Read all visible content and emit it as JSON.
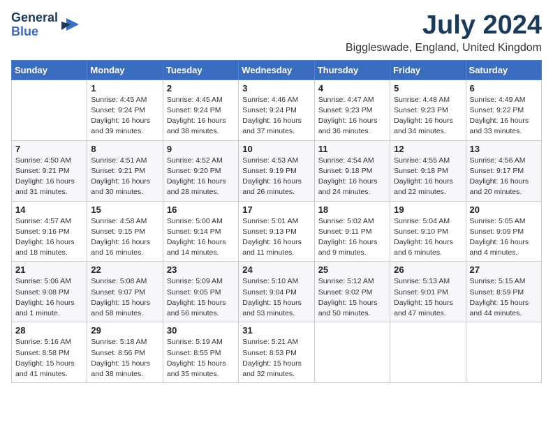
{
  "header": {
    "logo_line1": "General",
    "logo_line2": "Blue",
    "month_year": "July 2024",
    "location": "Biggleswade, England, United Kingdom"
  },
  "weekdays": [
    "Sunday",
    "Monday",
    "Tuesday",
    "Wednesday",
    "Thursday",
    "Friday",
    "Saturday"
  ],
  "weeks": [
    [
      {
        "day": "",
        "info": ""
      },
      {
        "day": "1",
        "info": "Sunrise: 4:45 AM\nSunset: 9:24 PM\nDaylight: 16 hours\nand 39 minutes."
      },
      {
        "day": "2",
        "info": "Sunrise: 4:45 AM\nSunset: 9:24 PM\nDaylight: 16 hours\nand 38 minutes."
      },
      {
        "day": "3",
        "info": "Sunrise: 4:46 AM\nSunset: 9:24 PM\nDaylight: 16 hours\nand 37 minutes."
      },
      {
        "day": "4",
        "info": "Sunrise: 4:47 AM\nSunset: 9:23 PM\nDaylight: 16 hours\nand 36 minutes."
      },
      {
        "day": "5",
        "info": "Sunrise: 4:48 AM\nSunset: 9:23 PM\nDaylight: 16 hours\nand 34 minutes."
      },
      {
        "day": "6",
        "info": "Sunrise: 4:49 AM\nSunset: 9:22 PM\nDaylight: 16 hours\nand 33 minutes."
      }
    ],
    [
      {
        "day": "7",
        "info": "Sunrise: 4:50 AM\nSunset: 9:21 PM\nDaylight: 16 hours\nand 31 minutes."
      },
      {
        "day": "8",
        "info": "Sunrise: 4:51 AM\nSunset: 9:21 PM\nDaylight: 16 hours\nand 30 minutes."
      },
      {
        "day": "9",
        "info": "Sunrise: 4:52 AM\nSunset: 9:20 PM\nDaylight: 16 hours\nand 28 minutes."
      },
      {
        "day": "10",
        "info": "Sunrise: 4:53 AM\nSunset: 9:19 PM\nDaylight: 16 hours\nand 26 minutes."
      },
      {
        "day": "11",
        "info": "Sunrise: 4:54 AM\nSunset: 9:18 PM\nDaylight: 16 hours\nand 24 minutes."
      },
      {
        "day": "12",
        "info": "Sunrise: 4:55 AM\nSunset: 9:18 PM\nDaylight: 16 hours\nand 22 minutes."
      },
      {
        "day": "13",
        "info": "Sunrise: 4:56 AM\nSunset: 9:17 PM\nDaylight: 16 hours\nand 20 minutes."
      }
    ],
    [
      {
        "day": "14",
        "info": "Sunrise: 4:57 AM\nSunset: 9:16 PM\nDaylight: 16 hours\nand 18 minutes."
      },
      {
        "day": "15",
        "info": "Sunrise: 4:58 AM\nSunset: 9:15 PM\nDaylight: 16 hours\nand 16 minutes."
      },
      {
        "day": "16",
        "info": "Sunrise: 5:00 AM\nSunset: 9:14 PM\nDaylight: 16 hours\nand 14 minutes."
      },
      {
        "day": "17",
        "info": "Sunrise: 5:01 AM\nSunset: 9:13 PM\nDaylight: 16 hours\nand 11 minutes."
      },
      {
        "day": "18",
        "info": "Sunrise: 5:02 AM\nSunset: 9:11 PM\nDaylight: 16 hours\nand 9 minutes."
      },
      {
        "day": "19",
        "info": "Sunrise: 5:04 AM\nSunset: 9:10 PM\nDaylight: 16 hours\nand 6 minutes."
      },
      {
        "day": "20",
        "info": "Sunrise: 5:05 AM\nSunset: 9:09 PM\nDaylight: 16 hours\nand 4 minutes."
      }
    ],
    [
      {
        "day": "21",
        "info": "Sunrise: 5:06 AM\nSunset: 9:08 PM\nDaylight: 16 hours\nand 1 minute."
      },
      {
        "day": "22",
        "info": "Sunrise: 5:08 AM\nSunset: 9:07 PM\nDaylight: 15 hours\nand 58 minutes."
      },
      {
        "day": "23",
        "info": "Sunrise: 5:09 AM\nSunset: 9:05 PM\nDaylight: 15 hours\nand 56 minutes."
      },
      {
        "day": "24",
        "info": "Sunrise: 5:10 AM\nSunset: 9:04 PM\nDaylight: 15 hours\nand 53 minutes."
      },
      {
        "day": "25",
        "info": "Sunrise: 5:12 AM\nSunset: 9:02 PM\nDaylight: 15 hours\nand 50 minutes."
      },
      {
        "day": "26",
        "info": "Sunrise: 5:13 AM\nSunset: 9:01 PM\nDaylight: 15 hours\nand 47 minutes."
      },
      {
        "day": "27",
        "info": "Sunrise: 5:15 AM\nSunset: 8:59 PM\nDaylight: 15 hours\nand 44 minutes."
      }
    ],
    [
      {
        "day": "28",
        "info": "Sunrise: 5:16 AM\nSunset: 8:58 PM\nDaylight: 15 hours\nand 41 minutes."
      },
      {
        "day": "29",
        "info": "Sunrise: 5:18 AM\nSunset: 8:56 PM\nDaylight: 15 hours\nand 38 minutes."
      },
      {
        "day": "30",
        "info": "Sunrise: 5:19 AM\nSunset: 8:55 PM\nDaylight: 15 hours\nand 35 minutes."
      },
      {
        "day": "31",
        "info": "Sunrise: 5:21 AM\nSunset: 8:53 PM\nDaylight: 15 hours\nand 32 minutes."
      },
      {
        "day": "",
        "info": ""
      },
      {
        "day": "",
        "info": ""
      },
      {
        "day": "",
        "info": ""
      }
    ]
  ]
}
